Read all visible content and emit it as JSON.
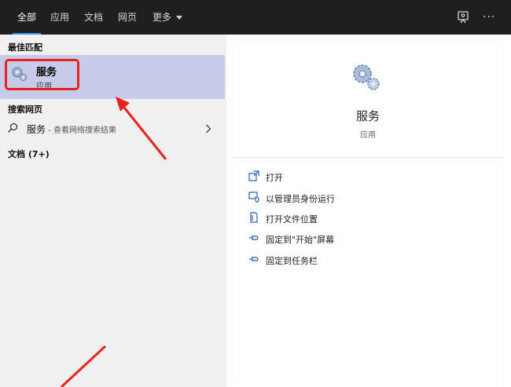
{
  "tabs": [
    {
      "label": "全部",
      "active": true
    },
    {
      "label": "应用"
    },
    {
      "label": "文档"
    },
    {
      "label": "网页"
    },
    {
      "label": "更多"
    }
  ],
  "left": {
    "best_match_heading": "最佳匹配",
    "best_match": {
      "title": "服务",
      "subtitle": "应用",
      "icon": "services-gear-icon"
    },
    "web_heading": "搜索网页",
    "web_result": {
      "term": "服务",
      "hint": " - 查看网络搜索结果"
    },
    "docs_heading": "文档 (7+)"
  },
  "right": {
    "title": "服务",
    "subtitle": "应用",
    "actions": [
      {
        "label": "打开",
        "icon": "open-icon"
      },
      {
        "label": "以管理员身份运行",
        "icon": "run-as-admin-icon"
      },
      {
        "label": "打开文件位置",
        "icon": "file-location-icon"
      },
      {
        "label": "固定到\"开始\"屏幕",
        "icon": "pin-icon"
      },
      {
        "label": "固定到任务栏",
        "icon": "pin-icon"
      }
    ]
  },
  "colors": {
    "topbar": "#1f1f1f",
    "selection": "#c5cbe8",
    "accent": "#3a8ee6",
    "annotation": "#e8231d"
  }
}
